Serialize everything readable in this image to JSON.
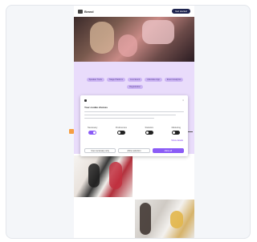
{
  "nav": {
    "logo_text": "Brand",
    "cta_label": "Get started"
  },
  "tags": [
    "Speaker Tools",
    "Stage Platform",
    "Live Event",
    "Attendee App",
    "Event Analytics",
    "Registration"
  ],
  "cookie_modal": {
    "close_label": "×",
    "title": "Your cookie choices",
    "toggles": [
      {
        "label": "Necessary",
        "on": true
      },
      {
        "label": "Preferences",
        "on": false
      },
      {
        "label": "Statistics",
        "on": false
      },
      {
        "label": "Marketing",
        "on": false
      }
    ],
    "details_label": "Show details",
    "deny_label": "Use necessary only",
    "allow_selection_label": "Allow selection",
    "allow_all_label": "Allow all"
  },
  "colors": {
    "accent": "#8b5cf6",
    "lavender": "#e9dcfb",
    "nav_button": "#1f2550"
  }
}
